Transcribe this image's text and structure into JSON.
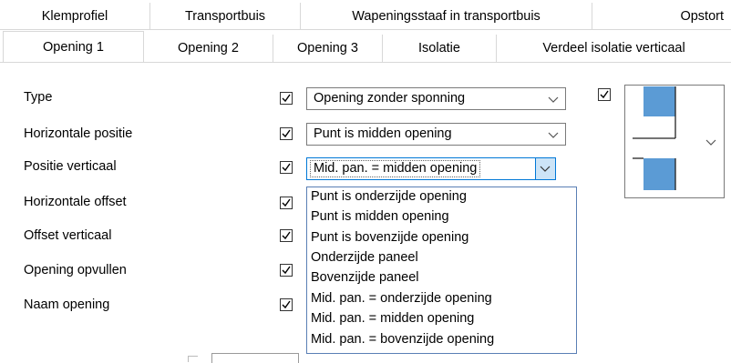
{
  "tabs_back": [
    {
      "label": "Klemprofiel"
    },
    {
      "label": "Transportbuis"
    },
    {
      "label": "Wapeningsstaaf in transportbuis"
    },
    {
      "label": "Opstort"
    }
  ],
  "tabs_front": [
    {
      "label": "Opening 1",
      "active": true
    },
    {
      "label": "Opening 2"
    },
    {
      "label": "Opening 3"
    },
    {
      "label": "Isolatie"
    },
    {
      "label": "Verdeel isolatie verticaal"
    }
  ],
  "fields": [
    {
      "label": "Type",
      "checked": true,
      "value": "Opening zonder sponning"
    },
    {
      "label": "Horizontale positie",
      "checked": true,
      "value": "Punt is midden opening"
    },
    {
      "label": "Positie verticaal",
      "checked": true,
      "value": "Mid. pan. = midden opening"
    },
    {
      "label": "Horizontale offset",
      "checked": true
    },
    {
      "label": "Offset verticaal",
      "checked": true
    },
    {
      "label": "Opening opvullen",
      "checked": true
    },
    {
      "label": "Naam opening",
      "checked": true
    }
  ],
  "dropdown_options": [
    "Punt is onderzijde opening",
    "Punt is midden opening",
    "Punt is bovenzijde opening",
    "Onderzijde paneel",
    "Bovenzijde paneel",
    "Mid. pan. = onderzijde opening",
    "Mid. pan. = midden opening",
    "Mid. pan. = bovenzijde opening"
  ],
  "preview_checkbox_checked": true,
  "icons": {
    "check": "check-icon",
    "arrow": "chevron-down-icon"
  },
  "colors": {
    "accent": "#0078d7",
    "shape": "#5b9bd5"
  }
}
